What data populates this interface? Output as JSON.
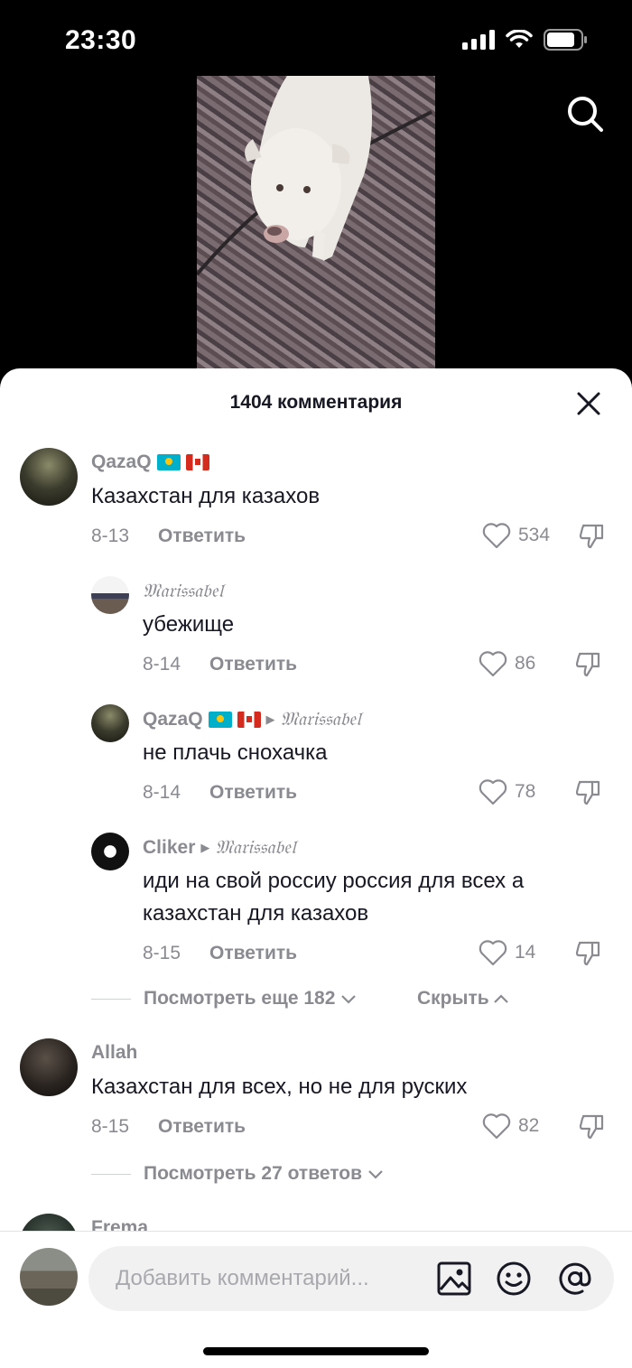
{
  "status_bar": {
    "time": "23:30"
  },
  "sheet": {
    "title": "1404 комментария",
    "comments": [
      {
        "user": "QazaQ",
        "text": "Казахстан для казахов",
        "date": "8-13",
        "reply": "Ответить",
        "likes": "534"
      },
      {
        "user": "𝔐𝔞𝔯𝔦𝔰𝔰𝔞𝔟𝔢𝔩",
        "text": "убежище",
        "date": "8-14",
        "reply": "Ответить",
        "likes": "86"
      },
      {
        "user": "QazaQ",
        "reply_to": "𝔐𝔞𝔯𝔦𝔰𝔰𝔞𝔟𝔢𝔩",
        "text": "не плачь снохачка",
        "date": "8-14",
        "reply": "Ответить",
        "likes": "78"
      },
      {
        "user": "Cliker",
        "reply_to": "𝔐𝔞𝔯𝔦𝔰𝔰𝔞𝔟𝔢𝔩",
        "text_line1": "иди на свой россиу россия для всех а",
        "text_line2": "казахстан для казахов",
        "date": "8-15",
        "reply": "Ответить",
        "likes": "14"
      },
      {
        "user": "Allah",
        "text": "Казахстан для всех, но не для руских",
        "date": "8-15",
        "reply": "Ответить",
        "likes": "82"
      },
      {
        "user": "Frema"
      }
    ],
    "view_more_1": "Посмотреть еще 182",
    "hide": "Скрыть",
    "view_more_2": "Посмотреть 27 ответов"
  },
  "input": {
    "placeholder": "Добавить комментарий..."
  }
}
